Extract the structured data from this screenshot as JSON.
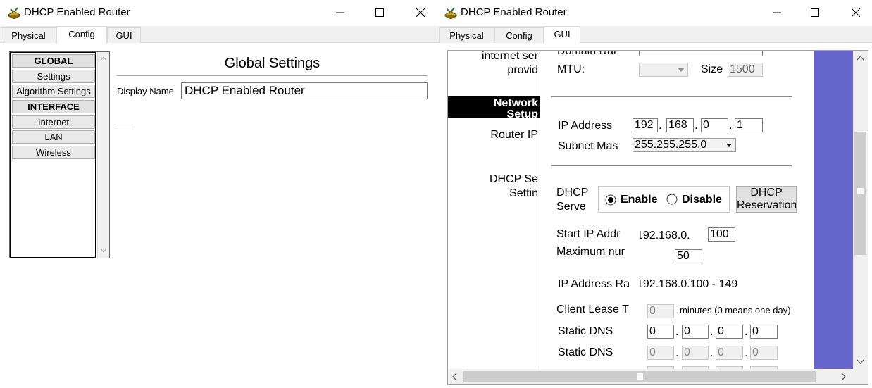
{
  "left_window": {
    "title": "DHCP Enabled Router",
    "tabs": [
      "Physical",
      "Config",
      "GUI"
    ],
    "active_tab": "Config",
    "sidebar": {
      "global_header": "GLOBAL",
      "settings": "Settings",
      "algorithm_settings": "Algorithm Settings",
      "interface_header": "INTERFACE",
      "internet": "Internet",
      "lan": "LAN",
      "wireless": "Wireless"
    },
    "main": {
      "title": "Global Settings",
      "display_name_label": "Display Name",
      "display_name_value": "DHCP Enabled Router"
    }
  },
  "right_window": {
    "title": "DHCP Enabled Router",
    "tabs": [
      "Physical",
      "Config",
      "GUI"
    ],
    "active_tab": "GUI",
    "left_panel": {
      "internet_service": "internet ser",
      "provid": "provid",
      "network_setup": "Network",
      "network_setup_2": "Setup",
      "router_ip": "Router IP",
      "dhcp_server": "DHCP Se",
      "settings": "Settin"
    },
    "form": {
      "domain_name_label": "Domain Nar",
      "mtu_label": "MTU:",
      "size_label": "Size",
      "size_value": "1500",
      "ip_address_label": "IP Address",
      "ip_octets": [
        "192",
        "168",
        "0",
        "1"
      ],
      "subnet_label": "Subnet Mas",
      "subnet_value": "255.255.255.0",
      "dhcp_server_label_1": "DHCP",
      "dhcp_server_label_2": "Serve",
      "enable_label": "Enable",
      "disable_label": "Disable",
      "reservation_button_1": "DHCP",
      "reservation_button_2": "Reservation",
      "start_ip_label": "Start IP Addr",
      "start_ip_prefix": "192.168.0.",
      "start_ip_value": "100",
      "max_num_label": "Maximum nur",
      "max_num_value": "50",
      "ip_range_label": "IP Address Ra",
      "ip_range_value": "192.168.0.100 - 149",
      "lease_label": "Client Lease T",
      "lease_value": "0",
      "lease_note": "minutes (0 means one day)",
      "static_dns1_label": "Static DNS",
      "static_dns1": [
        "0",
        "0",
        "0",
        "0"
      ],
      "static_dns2_label": "Static DNS",
      "static_dns2": [
        "0",
        "0",
        "0",
        "0"
      ]
    }
  },
  "colors": {
    "side_panel": "#6565cc",
    "network_bar": "#000000",
    "tab_bar": "#f0f0f0"
  }
}
